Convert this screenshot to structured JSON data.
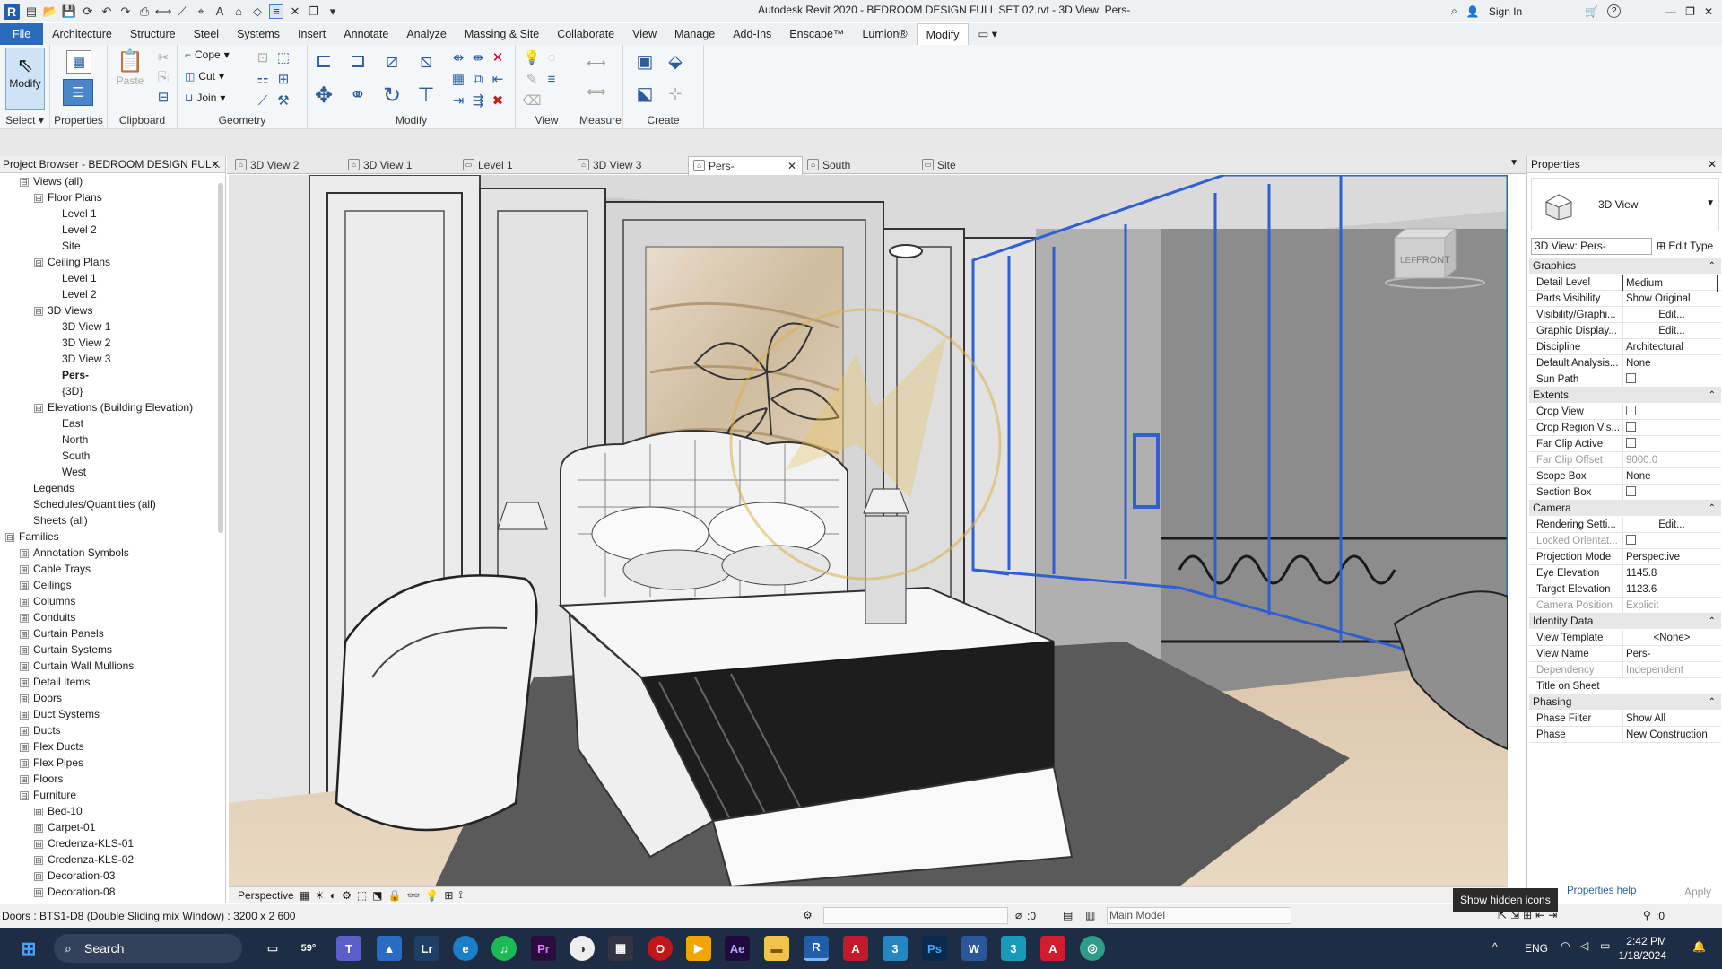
{
  "titlebar": {
    "title": "Autodesk Revit 2020 - BEDROOM DESIGN FULL SET 02.rvt - 3D View: Pers-",
    "sign_in": "Sign In",
    "help": "?"
  },
  "ribbon_tabs": [
    "File",
    "Architecture",
    "Structure",
    "Steel",
    "Systems",
    "Insert",
    "Annotate",
    "Analyze",
    "Massing & Site",
    "Collaborate",
    "View",
    "Manage",
    "Add-Ins",
    "Enscape™",
    "Lumion®",
    "Modify"
  ],
  "ribbon": {
    "select": {
      "modify": "Modify",
      "label": "Select ▾"
    },
    "properties": {
      "label": "Properties"
    },
    "clipboard": {
      "paste": "Paste",
      "label": "Clipboard"
    },
    "geometry": {
      "cope": "Cope",
      "cut": "Cut",
      "join": "Join",
      "label": "Geometry"
    },
    "modify_label": "Modify",
    "view_label": "View",
    "measure_label": "Measure",
    "create_label": "Create"
  },
  "project_browser": {
    "title": "Project Browser - BEDROOM DESIGN FUL...",
    "items": [
      {
        "label": "Views (all)",
        "exp": "⊟",
        "bold": false
      },
      {
        "label": "Floor Plans",
        "exp": "⊟",
        "bold": false
      },
      {
        "label": "Level 1",
        "exp": "",
        "bold": false
      },
      {
        "label": "Level 2",
        "exp": "",
        "bold": false
      },
      {
        "label": "Site",
        "exp": "",
        "bold": false
      },
      {
        "label": "Ceiling Plans",
        "exp": "⊟",
        "bold": false
      },
      {
        "label": "Level 1",
        "exp": "",
        "bold": false
      },
      {
        "label": "Level 2",
        "exp": "",
        "bold": false
      },
      {
        "label": "3D Views",
        "exp": "⊟",
        "bold": false
      },
      {
        "label": "3D View 1",
        "exp": "",
        "bold": false
      },
      {
        "label": "3D View 2",
        "exp": "",
        "bold": false
      },
      {
        "label": "3D View 3",
        "exp": "",
        "bold": false
      },
      {
        "label": "Pers-",
        "exp": "",
        "bold": true
      },
      {
        "label": "{3D}",
        "exp": "",
        "bold": false
      },
      {
        "label": "Elevations (Building Elevation)",
        "exp": "⊟",
        "bold": false
      },
      {
        "label": "East",
        "exp": "",
        "bold": false
      },
      {
        "label": "North",
        "exp": "",
        "bold": false
      },
      {
        "label": "South",
        "exp": "",
        "bold": false
      },
      {
        "label": "West",
        "exp": "",
        "bold": false
      },
      {
        "label": "Legends",
        "exp": "",
        "bold": false
      },
      {
        "label": "Schedules/Quantities (all)",
        "exp": "",
        "bold": false
      },
      {
        "label": "Sheets (all)",
        "exp": "",
        "bold": false
      },
      {
        "label": "Families",
        "exp": "⊟",
        "bold": false
      },
      {
        "label": "Annotation Symbols",
        "exp": "⊞",
        "bold": false
      },
      {
        "label": "Cable Trays",
        "exp": "⊞",
        "bold": false
      },
      {
        "label": "Ceilings",
        "exp": "⊞",
        "bold": false
      },
      {
        "label": "Columns",
        "exp": "⊞",
        "bold": false
      },
      {
        "label": "Conduits",
        "exp": "⊞",
        "bold": false
      },
      {
        "label": "Curtain Panels",
        "exp": "⊞",
        "bold": false
      },
      {
        "label": "Curtain Systems",
        "exp": "⊞",
        "bold": false
      },
      {
        "label": "Curtain Wall Mullions",
        "exp": "⊞",
        "bold": false
      },
      {
        "label": "Detail Items",
        "exp": "⊞",
        "bold": false
      },
      {
        "label": "Doors",
        "exp": "⊞",
        "bold": false
      },
      {
        "label": "Duct Systems",
        "exp": "⊞",
        "bold": false
      },
      {
        "label": "Ducts",
        "exp": "⊞",
        "bold": false
      },
      {
        "label": "Flex Ducts",
        "exp": "⊞",
        "bold": false
      },
      {
        "label": "Flex Pipes",
        "exp": "⊞",
        "bold": false
      },
      {
        "label": "Floors",
        "exp": "⊞",
        "bold": false
      },
      {
        "label": "Furniture",
        "exp": "⊟",
        "bold": false
      },
      {
        "label": "Bed-10",
        "exp": "⊞",
        "bold": false
      },
      {
        "label": "Carpet-01",
        "exp": "⊞",
        "bold": false
      },
      {
        "label": "Credenza-KLS-01",
        "exp": "⊞",
        "bold": false
      },
      {
        "label": "Credenza-KLS-02",
        "exp": "⊞",
        "bold": false
      },
      {
        "label": "Decoration-03",
        "exp": "⊞",
        "bold": false
      },
      {
        "label": "Decoration-08",
        "exp": "⊞",
        "bold": false
      }
    ]
  },
  "view_tabs": [
    "3D View 2",
    "3D View 1",
    "Level 1",
    "3D View 3",
    "Pers-",
    "South",
    "Site"
  ],
  "view_control": {
    "mode": "Perspective"
  },
  "viewcube": {
    "left": "LEF",
    "front": "FRONT"
  },
  "properties": {
    "title": "Properties",
    "type_name": "3D View",
    "view_selector": "3D View: Pers-",
    "edit_type": "Edit Type",
    "groups": [
      {
        "name": "Graphics",
        "rows": [
          {
            "k": "Detail Level",
            "v": "Medium"
          },
          {
            "k": "Parts Visibility",
            "v": "Show Original"
          },
          {
            "k": "Visibility/Graphi...",
            "v": "Edit..."
          },
          {
            "k": "Graphic Display...",
            "v": "Edit..."
          },
          {
            "k": "Discipline",
            "v": "Architectural"
          },
          {
            "k": "Default Analysis...",
            "v": "None"
          },
          {
            "k": "Sun Path",
            "v": "☐"
          }
        ]
      },
      {
        "name": "Extents",
        "rows": [
          {
            "k": "Crop View",
            "v": "☐"
          },
          {
            "k": "Crop Region Vis...",
            "v": "☐"
          },
          {
            "k": "Far Clip Active",
            "v": "☐"
          },
          {
            "k": "Far Clip Offset",
            "v": "9000.0"
          },
          {
            "k": "Scope Box",
            "v": "None"
          },
          {
            "k": "Section Box",
            "v": "☐"
          }
        ]
      },
      {
        "name": "Camera",
        "rows": [
          {
            "k": "Rendering Setti...",
            "v": "Edit..."
          },
          {
            "k": "Locked Orientat...",
            "v": "☐"
          },
          {
            "k": "Projection Mode",
            "v": "Perspective"
          },
          {
            "k": "Eye Elevation",
            "v": "1145.8"
          },
          {
            "k": "Target Elevation",
            "v": "1123.6"
          },
          {
            "k": "Camera Position",
            "v": "Explicit"
          }
        ]
      },
      {
        "name": "Identity Data",
        "rows": [
          {
            "k": "View Template",
            "v": "<None>"
          },
          {
            "k": "View Name",
            "v": "Pers-"
          },
          {
            "k": "Dependency",
            "v": "Independent"
          },
          {
            "k": "Title on Sheet",
            "v": ""
          }
        ]
      },
      {
        "name": "Phasing",
        "rows": [
          {
            "k": "Phase Filter",
            "v": "Show All"
          },
          {
            "k": "Phase",
            "v": "New Construction"
          }
        ]
      }
    ],
    "help_link": "Properties help",
    "apply": "Apply"
  },
  "status": {
    "text": "Doors : BTS1-D8 (Double Sliding mix Window) : 3200 x 2 600",
    "count1": ":0",
    "workset": "Main Model",
    "count2": ":0"
  },
  "tooltip": "Show hidden icons",
  "taskbar": {
    "search": "Search",
    "lang": "ENG",
    "time": "2:42 PM",
    "date": "1/18/2024",
    "weather": "59°"
  }
}
